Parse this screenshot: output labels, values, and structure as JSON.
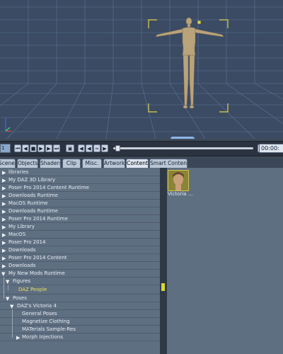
{
  "viewport": {
    "colors": {
      "background": "#3b4b63",
      "grid": "#5d7496",
      "figure": "#b9a37a",
      "bracket": "#e0d24a"
    }
  },
  "timeline": {
    "frame_value": "1",
    "time_value": "00:00:"
  },
  "tabs": [
    {
      "label": "Scenes"
    },
    {
      "label": "Objects"
    },
    {
      "label": "Shaders"
    },
    {
      "label": "Clip"
    },
    {
      "label": "Misc."
    },
    {
      "label": "Artwork"
    },
    {
      "label": "Content"
    },
    {
      "label": "Smart Content"
    }
  ],
  "tree": [
    {
      "label": "libraries"
    },
    {
      "label": "My DAZ 3D Library"
    },
    {
      "label": "Poser Pro 2014 Content Runtime"
    },
    {
      "label": "Downloads Runtime"
    },
    {
      "label": "MacOS Runtime"
    },
    {
      "label": "Downloads Runtime"
    },
    {
      "label": "Poser Pro 2014 Runtime"
    },
    {
      "label": "My Library"
    },
    {
      "label": "MacOS"
    },
    {
      "label": "Poser Pro 2014"
    },
    {
      "label": "Downloads"
    },
    {
      "label": "Poser Pro 2014 Content"
    },
    {
      "label": "Downloads"
    },
    {
      "label": "My New Mods Runtime"
    },
    {
      "label": "Figures"
    },
    {
      "label": "DAZ People"
    },
    {
      "label": "Poses"
    },
    {
      "label": "DAZ's Victoria 4"
    },
    {
      "label": "General Poses"
    },
    {
      "label": "Magnetize Clothing"
    },
    {
      "label": "MATerials Sample-Res"
    },
    {
      "label": "Morph Injections"
    }
  ],
  "content_items": [
    {
      "label": "Victoria ..."
    }
  ]
}
